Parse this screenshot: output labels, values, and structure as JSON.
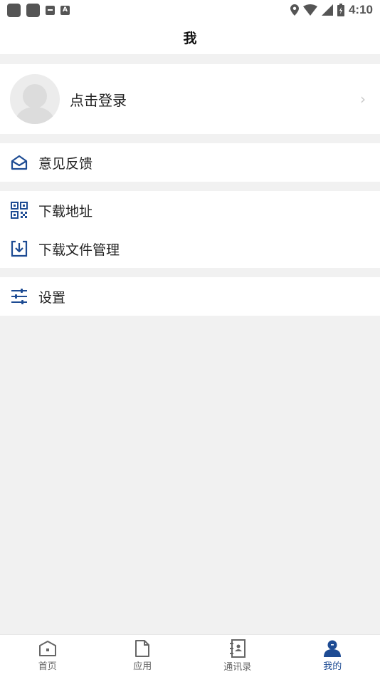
{
  "status": {
    "time": "4:10",
    "icons": [
      "app-icon",
      "app-icon",
      "mail-icon",
      "a-icon",
      "location-icon",
      "wifi-icon",
      "signal-icon",
      "battery-icon"
    ]
  },
  "header": {
    "title": "我"
  },
  "profile": {
    "login_text": "点击登录"
  },
  "menu": {
    "feedback": "意见反馈",
    "download_address": "下载地址",
    "download_files": "下载文件管理",
    "settings": "设置"
  },
  "tabs": [
    {
      "label": "首页",
      "icon": "home-icon"
    },
    {
      "label": "应用",
      "icon": "document-icon"
    },
    {
      "label": "通讯录",
      "icon": "contacts-icon"
    },
    {
      "label": "我的",
      "icon": "user-icon",
      "active": true
    }
  ],
  "colors": {
    "accent": "#1d4b93",
    "background": "#f1f1f1"
  }
}
